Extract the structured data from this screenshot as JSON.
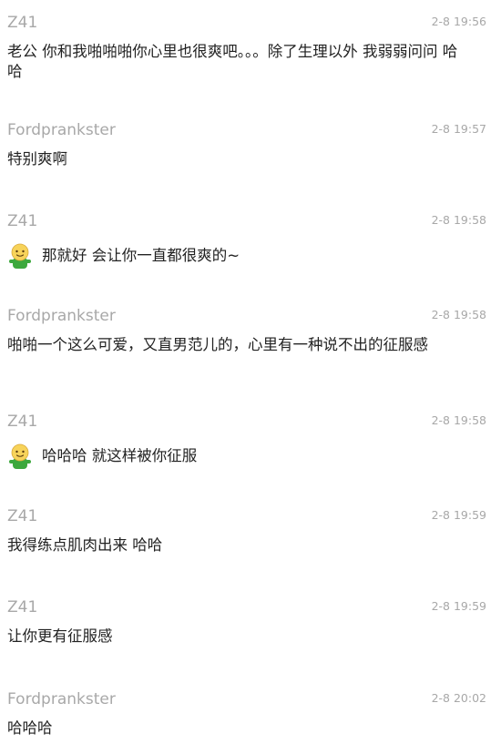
{
  "messages": [
    {
      "sender": "Z41",
      "time": "2-8 19:56",
      "text": "老公 你和我啪啪啪你心里也很爽吧。。。除了生理以外 我弱弱问问 哈哈"
    },
    {
      "sender": "Fordprankster",
      "time": "2-8 19:57",
      "text": "特别爽啊"
    },
    {
      "sender": "Z41",
      "time": "2-8 19:58",
      "text": "那就好 会让你一直都很爽的~",
      "icon": "smiley-icon"
    },
    {
      "sender": "Fordprankster",
      "time": "2-8 19:58",
      "text": "啪啪一个这么可爱，又直男范儿的，心里有一种说不出的征服感"
    },
    {
      "sender": "Z41",
      "time": "2-8 19:58",
      "text": "哈哈哈 就这样被你征服",
      "icon": "smiley-icon"
    },
    {
      "sender": "Z41",
      "time": "2-8 19:59",
      "text": "我得练点肌肉出来 哈哈"
    },
    {
      "sender": "Z41",
      "time": "2-8 19:59",
      "text": "让你更有征服感"
    },
    {
      "sender": "Fordprankster",
      "time": "2-8 20:02",
      "text": "哈哈哈"
    }
  ]
}
